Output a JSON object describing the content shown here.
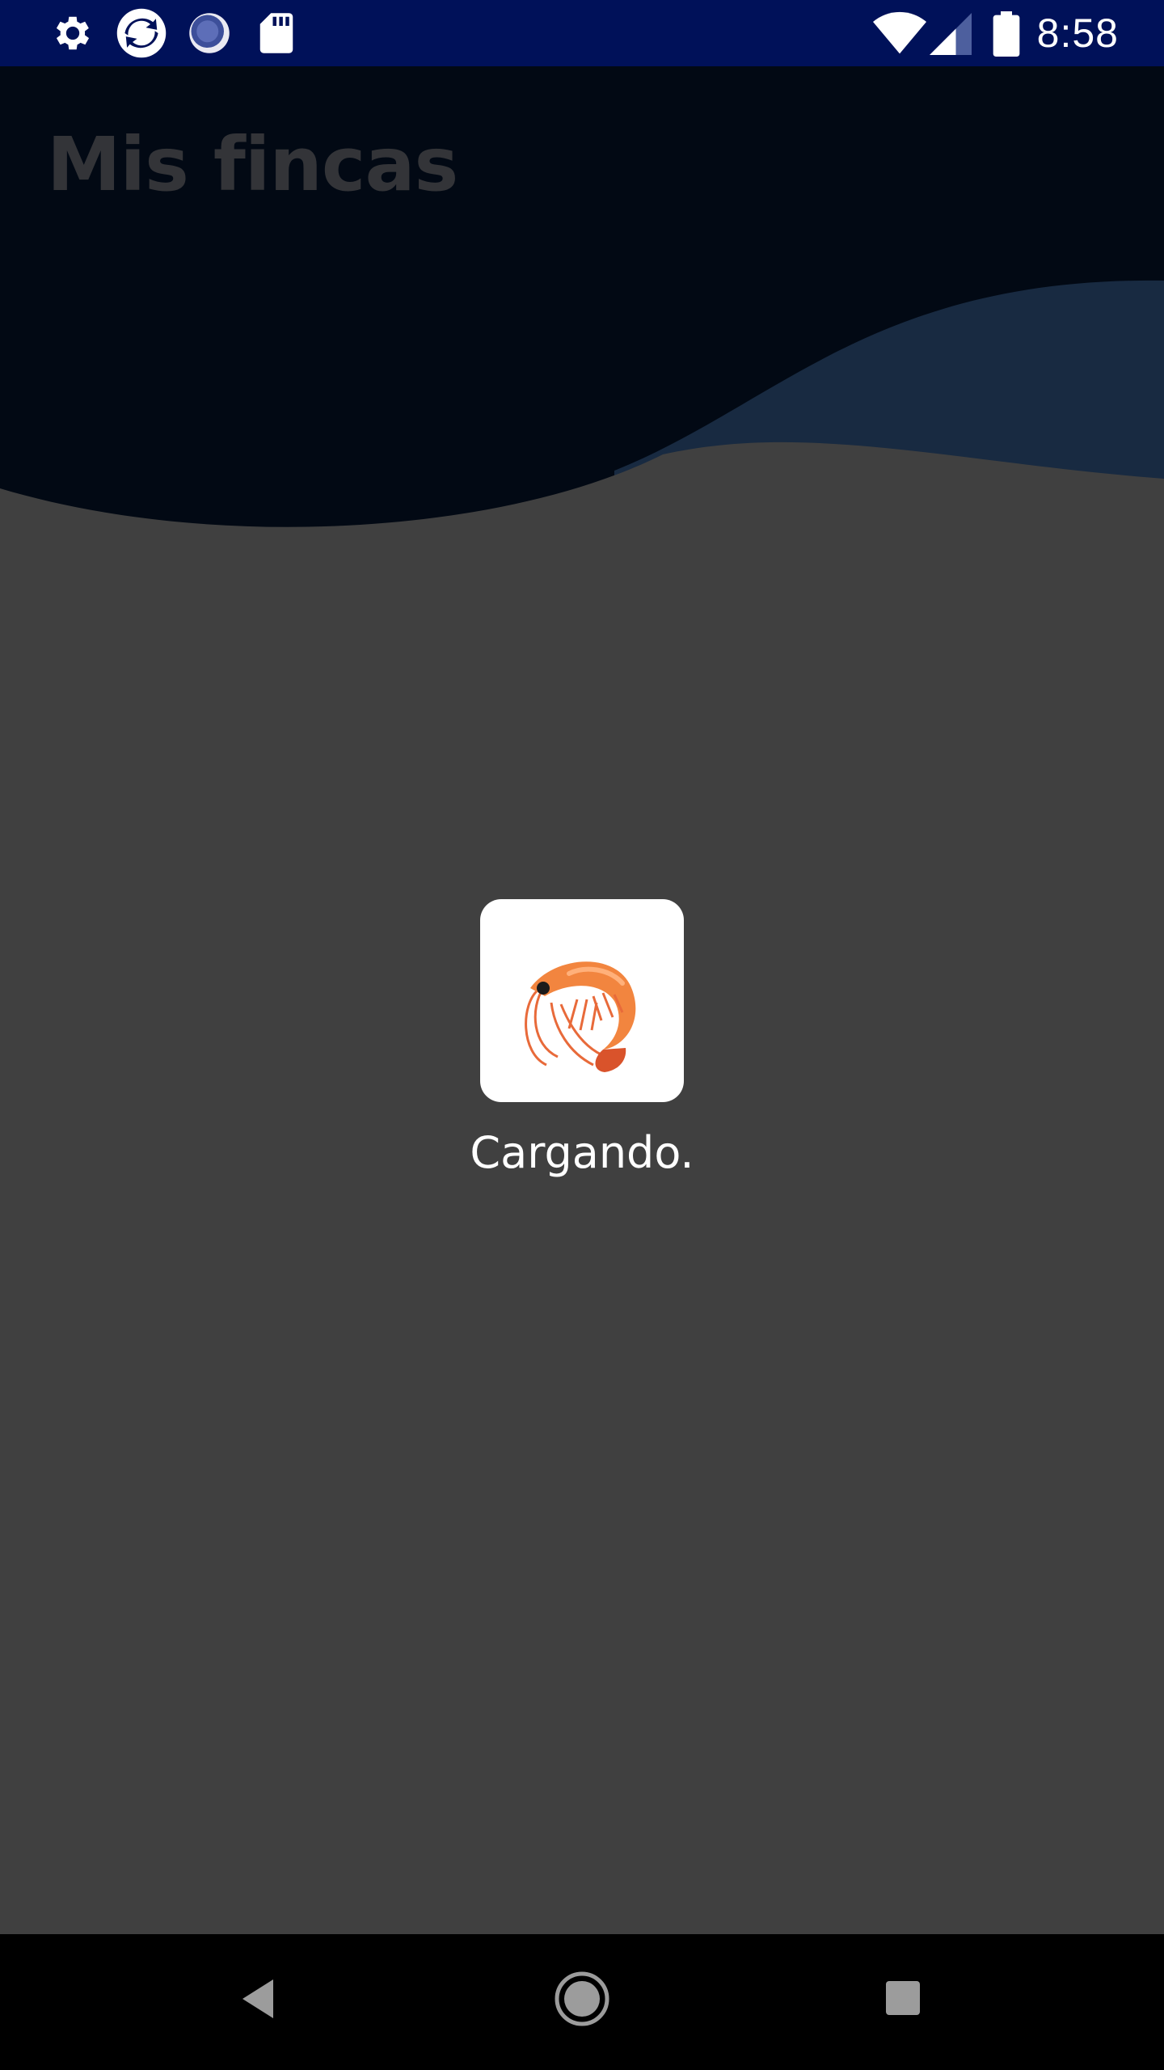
{
  "status_bar": {
    "time": "8:58",
    "left_icons": [
      "gear-icon",
      "sync-app-icon",
      "loading-app-icon",
      "sd-card-icon"
    ],
    "right_icons": [
      "wifi-icon",
      "cell-signal-icon",
      "battery-icon"
    ],
    "background_color": "#001159"
  },
  "header": {
    "title": "Mis fincas"
  },
  "loader": {
    "icon": "shrimp-icon",
    "text": "Cargando."
  },
  "nav_bar": {
    "buttons": [
      "back-button",
      "home-button",
      "recents-button"
    ]
  },
  "colors": {
    "overlay": "#404040",
    "header_dark": "#020914",
    "wave_accent": "#182a41",
    "shrimp": "#f2853f"
  }
}
